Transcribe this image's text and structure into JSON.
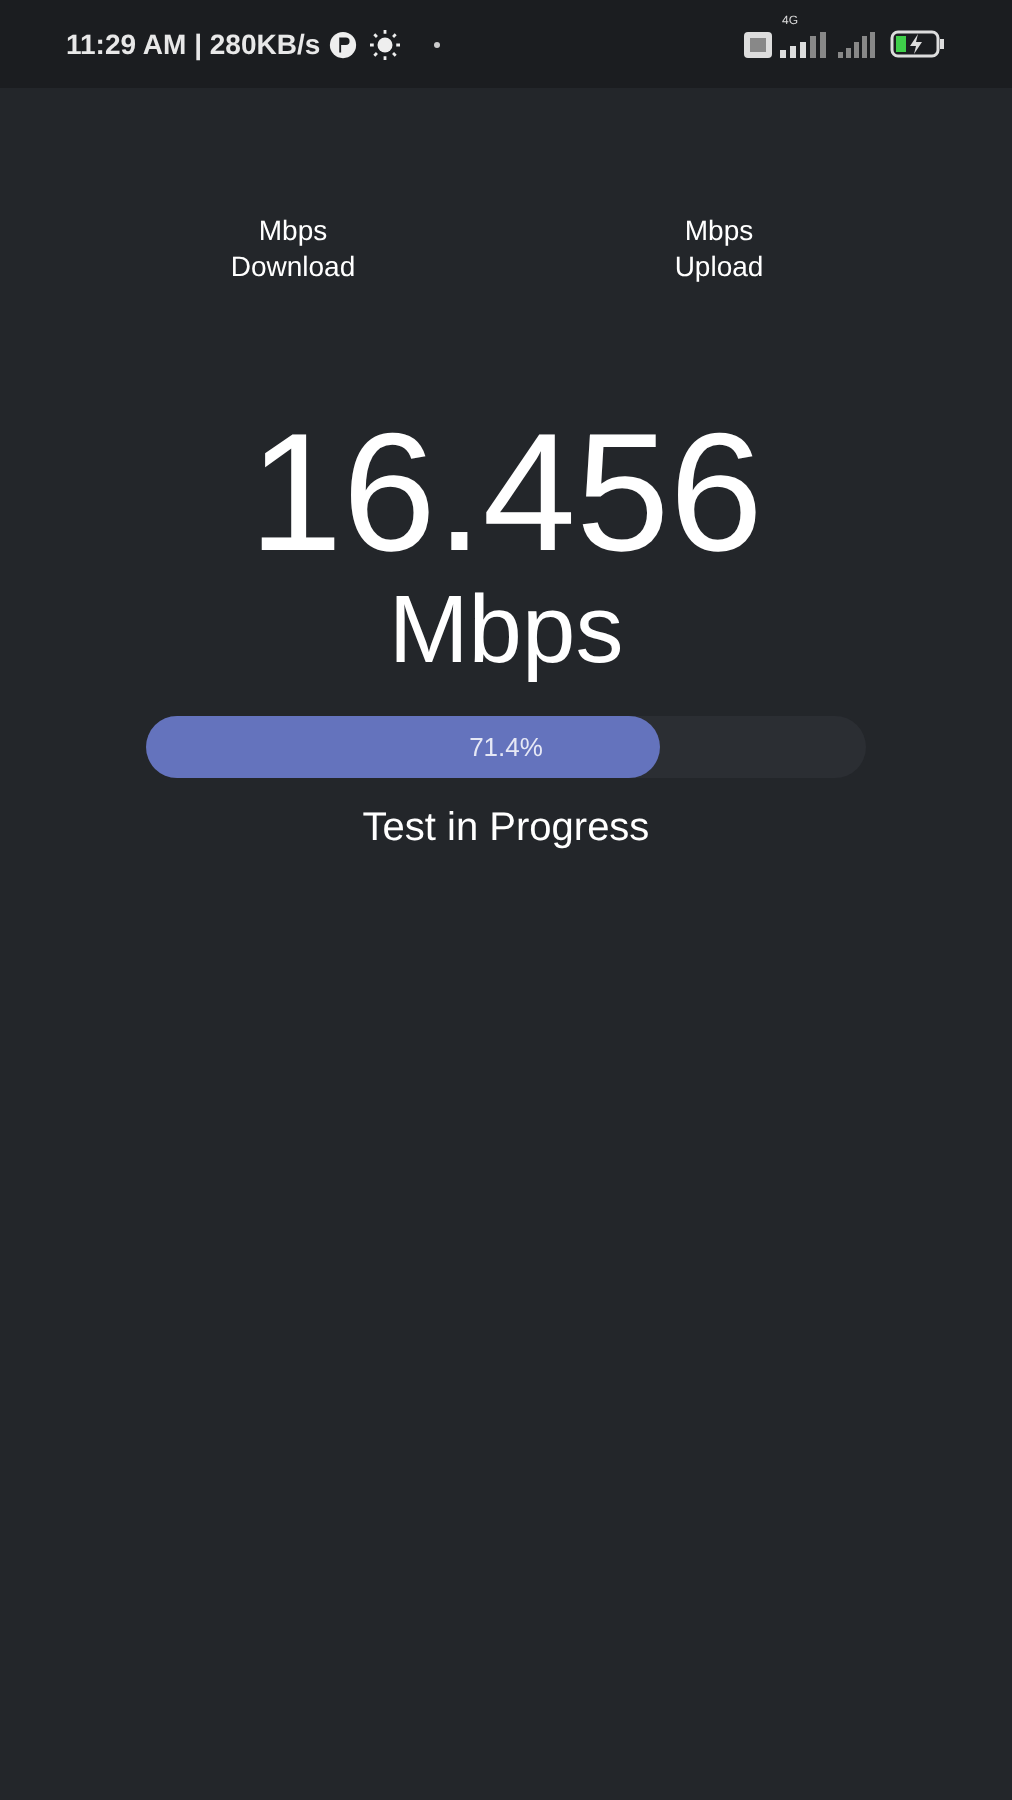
{
  "status_bar": {
    "time": "11:29 AM | 280KB/s",
    "network": "4G"
  },
  "speeds": [
    {
      "unit": "Mbps",
      "label": "Download"
    },
    {
      "unit": "Mbps",
      "label": "Upload"
    }
  ],
  "reading": {
    "value": "16.456",
    "unit": "Mbps"
  },
  "progress": {
    "level": 0.714,
    "label": "71.4%"
  },
  "status": "Test in Progress"
}
